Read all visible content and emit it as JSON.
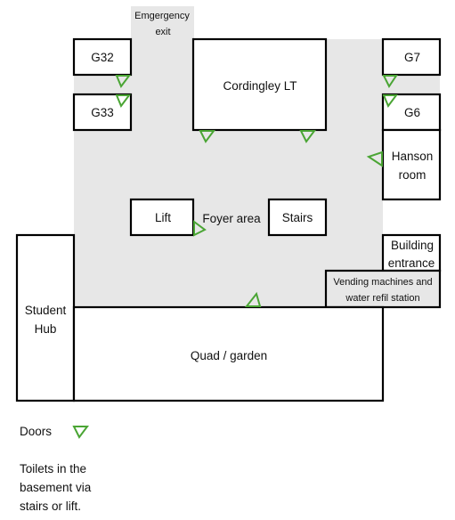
{
  "rooms": {
    "emergency_exit": [
      "Emgergency",
      "exit"
    ],
    "g32": "G32",
    "g33": "G33",
    "cordingley": "Cordingley LT",
    "g7": "G7",
    "g6": "G6",
    "hanson": [
      "Hanson",
      "room"
    ],
    "lift": "Lift",
    "foyer": "Foyer area",
    "stairs": "Stairs",
    "entrance": [
      "Building",
      "entrance"
    ],
    "vending": [
      "Vending machines and",
      "water refil station"
    ],
    "student_hub": [
      "Student",
      "Hub"
    ],
    "quad": "Quad / garden"
  },
  "legend": {
    "doors_label": "Doors",
    "note": [
      "Toilets in the",
      "basement via",
      "stairs or lift."
    ]
  },
  "colors": {
    "door": "#4aa534",
    "corridor": "#e7e7e7"
  }
}
